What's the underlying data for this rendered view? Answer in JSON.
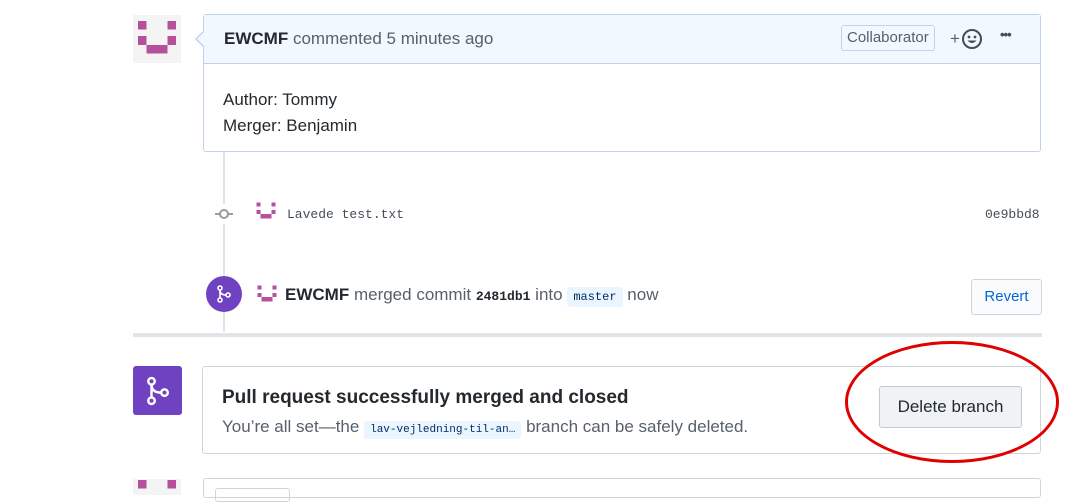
{
  "top_comment": {
    "author": "EWCMF",
    "action": "commented",
    "time": "5 minutes ago",
    "badge": "Collaborator",
    "reaction_plus": "+",
    "more": "•••",
    "body_lines": [
      "Author: Tommy",
      "Merger: Benjamin"
    ]
  },
  "commit": {
    "message": "Lavede test.txt",
    "sha": "0e9bbd8"
  },
  "merge_event": {
    "author": "EWCMF",
    "text_before": "merged commit",
    "commit_sha": "2481db1",
    "text_into": "into",
    "branch": "master",
    "text_after": "now",
    "revert_label": "Revert"
  },
  "merge_status": {
    "title": "Pull request successfully merged and closed",
    "desc_before": "You’re all set—the",
    "branch": "lav-vejledning-til-an…",
    "desc_after": "branch can be safely deleted.",
    "delete_label": "Delete branch"
  },
  "colors": {
    "avatar": "#b6509c",
    "merge_purple": "#6f42c1",
    "link_blue": "#0366d6",
    "highlight_red": "#e00000"
  }
}
